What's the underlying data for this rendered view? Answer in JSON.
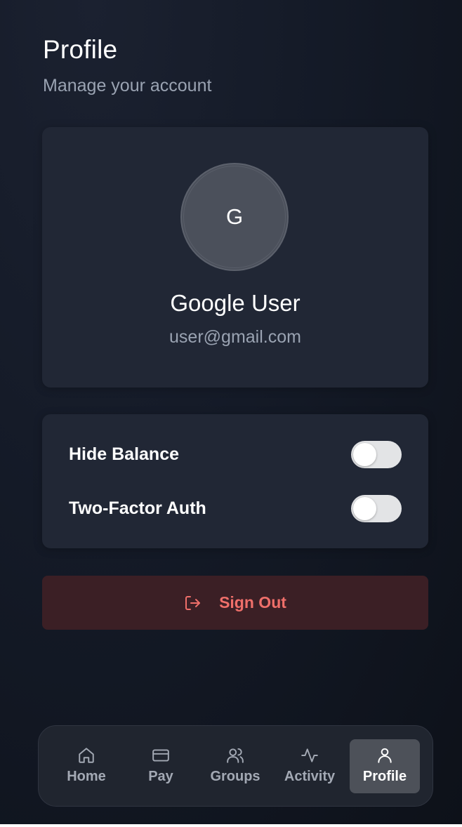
{
  "header": {
    "title": "Profile",
    "subtitle": "Manage your account"
  },
  "profile": {
    "avatar_initial": "G",
    "name": "Google User",
    "email": "user@gmail.com"
  },
  "settings": {
    "items": [
      {
        "label": "Hide Balance",
        "enabled": false
      },
      {
        "label": "Two-Factor Auth",
        "enabled": false
      }
    ]
  },
  "signout": {
    "label": "Sign Out",
    "icon": "logout-icon",
    "color": "#ef6f6a"
  },
  "nav": {
    "items": [
      {
        "label": "Home",
        "icon": "home-icon",
        "active": false
      },
      {
        "label": "Pay",
        "icon": "credit-card-icon",
        "active": false
      },
      {
        "label": "Groups",
        "icon": "users-icon",
        "active": false
      },
      {
        "label": "Activity",
        "icon": "activity-icon",
        "active": false
      },
      {
        "label": "Profile",
        "icon": "user-icon",
        "active": true
      }
    ]
  }
}
